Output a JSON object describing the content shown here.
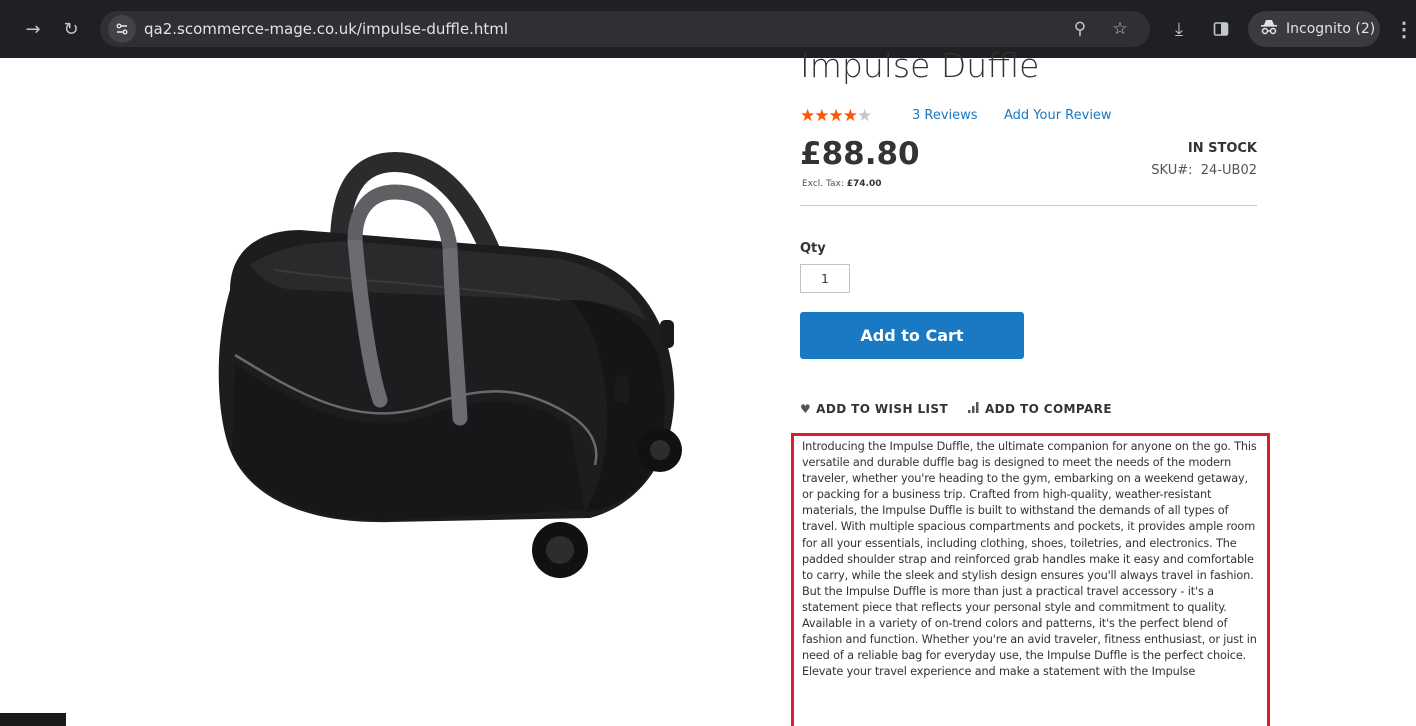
{
  "browser": {
    "url": "qa2.scommerce-mage.co.uk/impulse-duffle.html",
    "profile_label": "Incognito (2)",
    "icons": [
      "forward-arrow-icon",
      "reload-icon",
      "site-info-icon",
      "zoom-icon",
      "bookmark-star-icon",
      "download-icon",
      "side-panel-icon",
      "incognito-icon",
      "more-menu-icon"
    ]
  },
  "product": {
    "title": "Impulse Duffle",
    "rating_stars_filled": 4,
    "rating_stars_total": 5,
    "reviews_link": "3  Reviews",
    "add_review_link": "Add Your Review",
    "price": "£88.80",
    "excl_tax_label": "Excl. Tax:",
    "excl_tax_value": "£74.00",
    "stock_status": "IN STOCK",
    "sku_label": "SKU#:",
    "sku_value": "24-UB02",
    "qty_label": "Qty",
    "qty_value": "1",
    "add_to_cart_label": "Add to Cart",
    "wishlist_label": "ADD TO WISH LIST",
    "compare_label": "ADD TO COMPARE",
    "description": "Introducing the Impulse Duffle, the ultimate companion for anyone on the go. This versatile and durable duffle bag is designed to meet the needs of the modern traveler, whether you're heading to the gym, embarking on a weekend getaway, or packing for a business trip. Crafted from high-quality, weather-resistant materials, the Impulse Duffle is built to withstand the demands of all types of travel. With multiple spacious compartments and pockets, it provides ample room for all your essentials, including clothing, shoes, toiletries, and electronics. The padded shoulder strap and reinforced grab handles make it easy and comfortable to carry, while the sleek and stylish design ensures you'll always travel in fashion. But the Impulse Duffle is more than just a practical travel accessory - it's a statement piece that reflects your personal style and commitment to quality. Available in a variety of on-trend colors and patterns, it's the perfect blend of fashion and function. Whether you're an avid traveler, fitness enthusiast, or just in need of a reliable bag for everyday use, the Impulse Duffle is the perfect choice. Elevate your travel experience and make a statement with the Impulse"
  },
  "colors": {
    "toolbar_bg": "#1f2023",
    "link_blue": "#1979c3",
    "button_blue": "#1979c3",
    "star_orange": "#ff5501",
    "highlight_red": "#dc1c2a"
  }
}
